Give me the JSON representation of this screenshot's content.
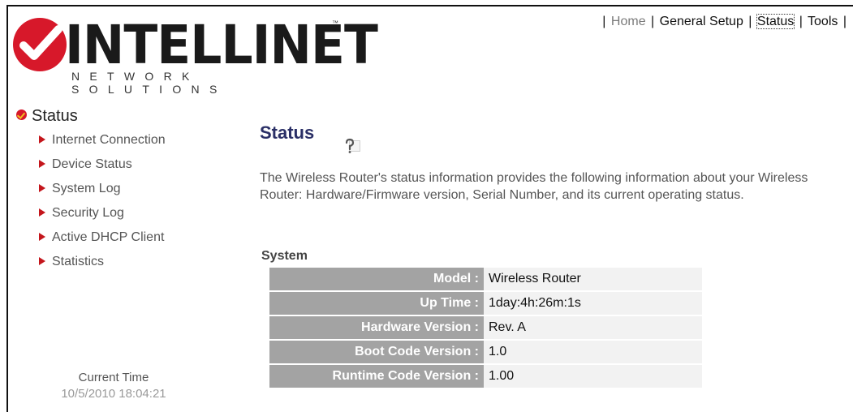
{
  "logo": {
    "brand": "INTELLINET",
    "tagline": "NETWORK SOLUTIONS",
    "tm": "™"
  },
  "topnav": {
    "items": [
      {
        "label": "Home"
      },
      {
        "label": "General Setup"
      },
      {
        "label": "Status"
      },
      {
        "label": "Tools"
      }
    ],
    "separator": "|"
  },
  "sidebar": {
    "title": "Status",
    "items": [
      {
        "label": "Internet Connection"
      },
      {
        "label": "Device Status"
      },
      {
        "label": "System Log"
      },
      {
        "label": "Security Log"
      },
      {
        "label": "Active DHCP Client"
      },
      {
        "label": "Statistics"
      }
    ],
    "current_time_label": "Current Time",
    "current_time_value": "10/5/2010 18:04:21"
  },
  "main": {
    "title": "Status",
    "description": "The Wireless Router's status information provides the following information about your Wireless Router: Hardware/Firmware version, Serial Number, and its current operating status.",
    "section": "System",
    "rows": [
      {
        "label": "Model :",
        "value": "Wireless Router"
      },
      {
        "label": "Up Time :",
        "value": "1day:4h:26m:1s"
      },
      {
        "label": "Hardware Version :",
        "value": "Rev. A"
      },
      {
        "label": "Boot Code Version :",
        "value": "1.0"
      },
      {
        "label": "Runtime Code Version :",
        "value": "1.00"
      }
    ]
  },
  "icons": {
    "logo": "intellinet-check-logo-icon",
    "help": "help-icon",
    "sidebar_bullet": "red-triangle-bullet-icon",
    "title_bullet": "red-check-dot-icon"
  },
  "colors": {
    "brand_red": "#d7182a",
    "title_navy": "#2a2f66",
    "table_label_bg": "#a3a3a3",
    "table_value_bg": "#f2f2f2"
  }
}
